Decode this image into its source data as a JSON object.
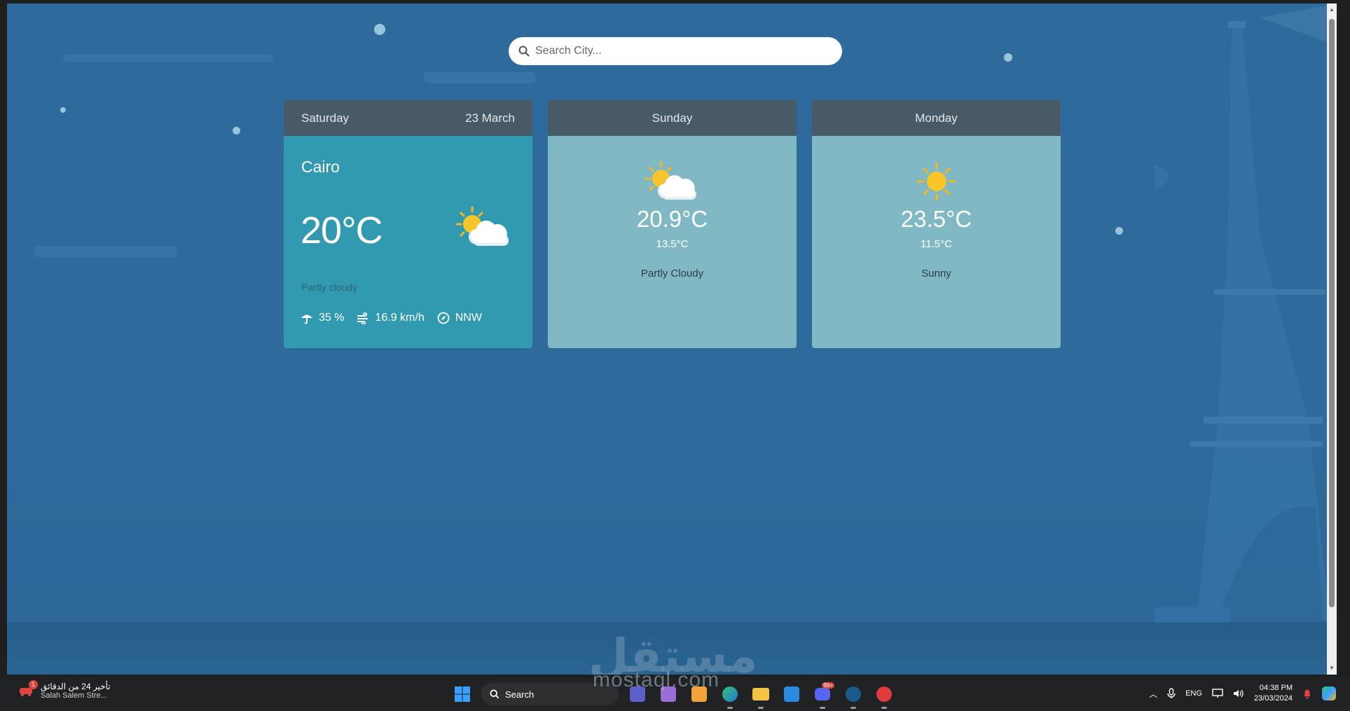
{
  "search": {
    "placeholder": "Search City..."
  },
  "today": {
    "day": "Saturday",
    "date": "23 March",
    "city": "Cairo",
    "temp": "20°C",
    "condition": "Partly cloudy",
    "rain": "35 %",
    "wind_speed": "16.9 km/h",
    "wind_dir": "NNW"
  },
  "forecast": [
    {
      "day": "Sunday",
      "max": "20.9°C",
      "min": "13.5°C",
      "condition": "Partly Cloudy",
      "icon": "partly-cloudy-icon"
    },
    {
      "day": "Monday",
      "max": "23.5°C",
      "min": "11.5°C",
      "condition": "Sunny",
      "icon": "sun-icon"
    }
  ],
  "watermark": {
    "arabic": "مستقل",
    "latin": "mostaql.com"
  },
  "taskbar": {
    "notification_title": "تأخير 24 من الدقائق",
    "notification_sub": "Salah Salem Stre...",
    "notification_count": "1",
    "search_label": "Search",
    "discord_badge": "99+",
    "language": "ENG",
    "time": "04:38 PM",
    "date": "23/03/2024"
  },
  "colors": {
    "background": "#2f6a9c",
    "today_card": "#3199b0",
    "forecast_card": "#80b9c4",
    "card_header": "#485a66"
  }
}
